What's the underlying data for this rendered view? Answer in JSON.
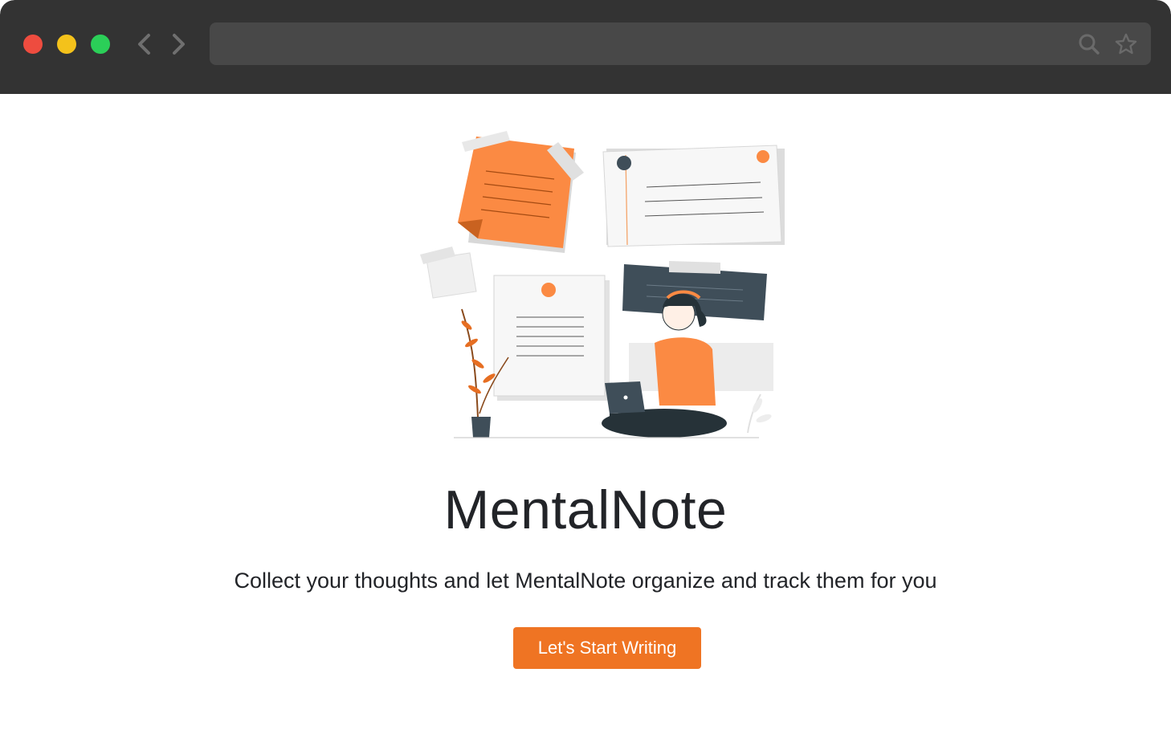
{
  "browser": {
    "address_value": "",
    "icons": [
      "chevron-left-icon",
      "chevron-right-icon",
      "search-icon",
      "star-icon"
    ]
  },
  "hero": {
    "title": "MentalNote",
    "subtitle": "Collect your thoughts and let MentalNote organize and track them for you",
    "cta_label": "Let's Start Writing"
  },
  "colors": {
    "accent": "#ef7423",
    "titlebar": "#333333",
    "addressbar": "#484848",
    "text": "#222428",
    "dark_slate": "#3f4e59"
  }
}
